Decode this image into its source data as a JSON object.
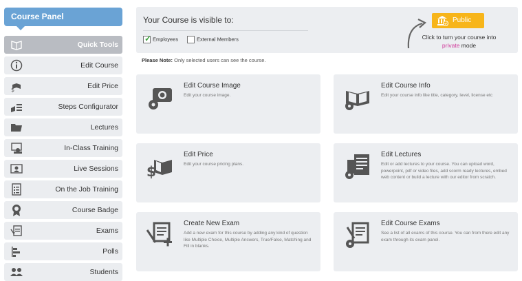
{
  "sidebar": {
    "header": "Course Panel",
    "items": [
      {
        "label": "Quick Tools",
        "icon": "quick-tools-icon",
        "active": true
      },
      {
        "label": "Edit Course",
        "icon": "info-icon"
      },
      {
        "label": "Edit Price",
        "icon": "price-icon"
      },
      {
        "label": "Steps Configurator",
        "icon": "steps-icon"
      },
      {
        "label": "Lectures",
        "icon": "folder-icon"
      },
      {
        "label": "In-Class Training",
        "icon": "classroom-icon"
      },
      {
        "label": "Live Sessions",
        "icon": "live-session-icon"
      },
      {
        "label": "On the Job Training",
        "icon": "checklist-icon"
      },
      {
        "label": "Course Badge",
        "icon": "badge-icon"
      },
      {
        "label": "Exams",
        "icon": "exam-icon"
      },
      {
        "label": "Polls",
        "icon": "polls-icon"
      },
      {
        "label": "Students",
        "icon": "students-icon"
      }
    ]
  },
  "visibility": {
    "title": "Your Course is visible to:",
    "employees_label": "Employees",
    "employees_checked": true,
    "external_label": "External Members",
    "external_checked": false,
    "public_button": "Public",
    "turn_text_before": "Click to turn your course into ",
    "turn_text_accent": "private",
    "turn_text_after": " mode",
    "accent_color": "#d0389a",
    "button_color": "#f7b51a"
  },
  "note": {
    "bold": "Please Note:",
    "text": " Only selected users can see the course."
  },
  "cards": [
    {
      "title": "Edit Course Image",
      "desc": "Edit your course image.",
      "icon": "course-image-icon"
    },
    {
      "title": "Edit Course Info",
      "desc": "Edit your course info like title, category, level, license etc",
      "icon": "course-info-icon"
    },
    {
      "title": "Edit Price",
      "desc": "Edit your course pricing plans.",
      "icon": "price-icon"
    },
    {
      "title": "Edit Lectures",
      "desc": "Edit or add lectures to your course. You can upload word, powerpoint, pdf or video files, add scorm ready lectures, embed web content or build a lecture with our editor from scratch.",
      "icon": "lectures-icon"
    },
    {
      "title": "Create New Exam",
      "desc": "Add a new exam for this course by adding any kind of question like Multiple Choice, Multiple Answers, True/False, Matching and Fill in blanks.",
      "icon": "new-exam-icon"
    },
    {
      "title": "Edit Course Exams",
      "desc": "See a list of all exams of this course. You can from there edit any exam through its exam panel.",
      "icon": "course-exams-icon"
    }
  ]
}
